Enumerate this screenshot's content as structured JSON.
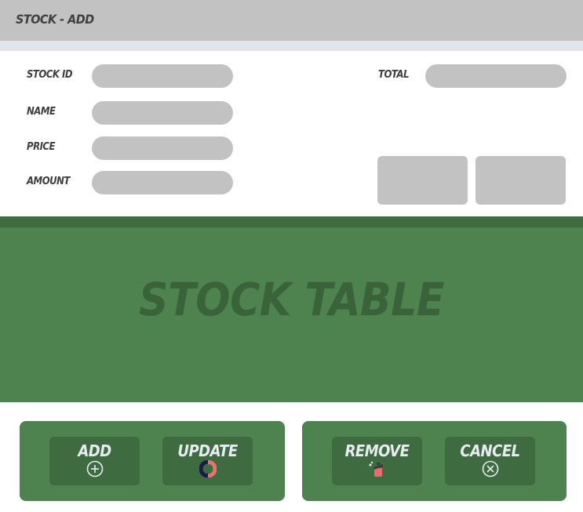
{
  "window": {
    "title": "STOCK - ADD"
  },
  "form": {
    "stock_id_label": "STOCK ID",
    "name_label": "NAME",
    "price_label": "PRICE",
    "amount_label": "AMOUNT",
    "total_label": "TOTAL",
    "stock_id_value": "",
    "name_value": "",
    "price_value": "",
    "amount_value": "",
    "total_value": ""
  },
  "table": {
    "title": "STOCK TABLE"
  },
  "buttons": {
    "add_label": "ADD",
    "add_icon": "plus-circle-icon",
    "update_label": "UPDATE",
    "update_icon": "refresh-icon",
    "remove_label": "REMOVE",
    "remove_icon": "trash-icon",
    "cancel_label": "CANCEL",
    "cancel_icon": "x-circle-icon"
  },
  "colors": {
    "title_bar": "#c2c2c2",
    "field_fill": "#c2c2c2",
    "green_panel": "#4e824e",
    "green_dark": "#3f6b40",
    "button_text": "#e8ecf2"
  }
}
